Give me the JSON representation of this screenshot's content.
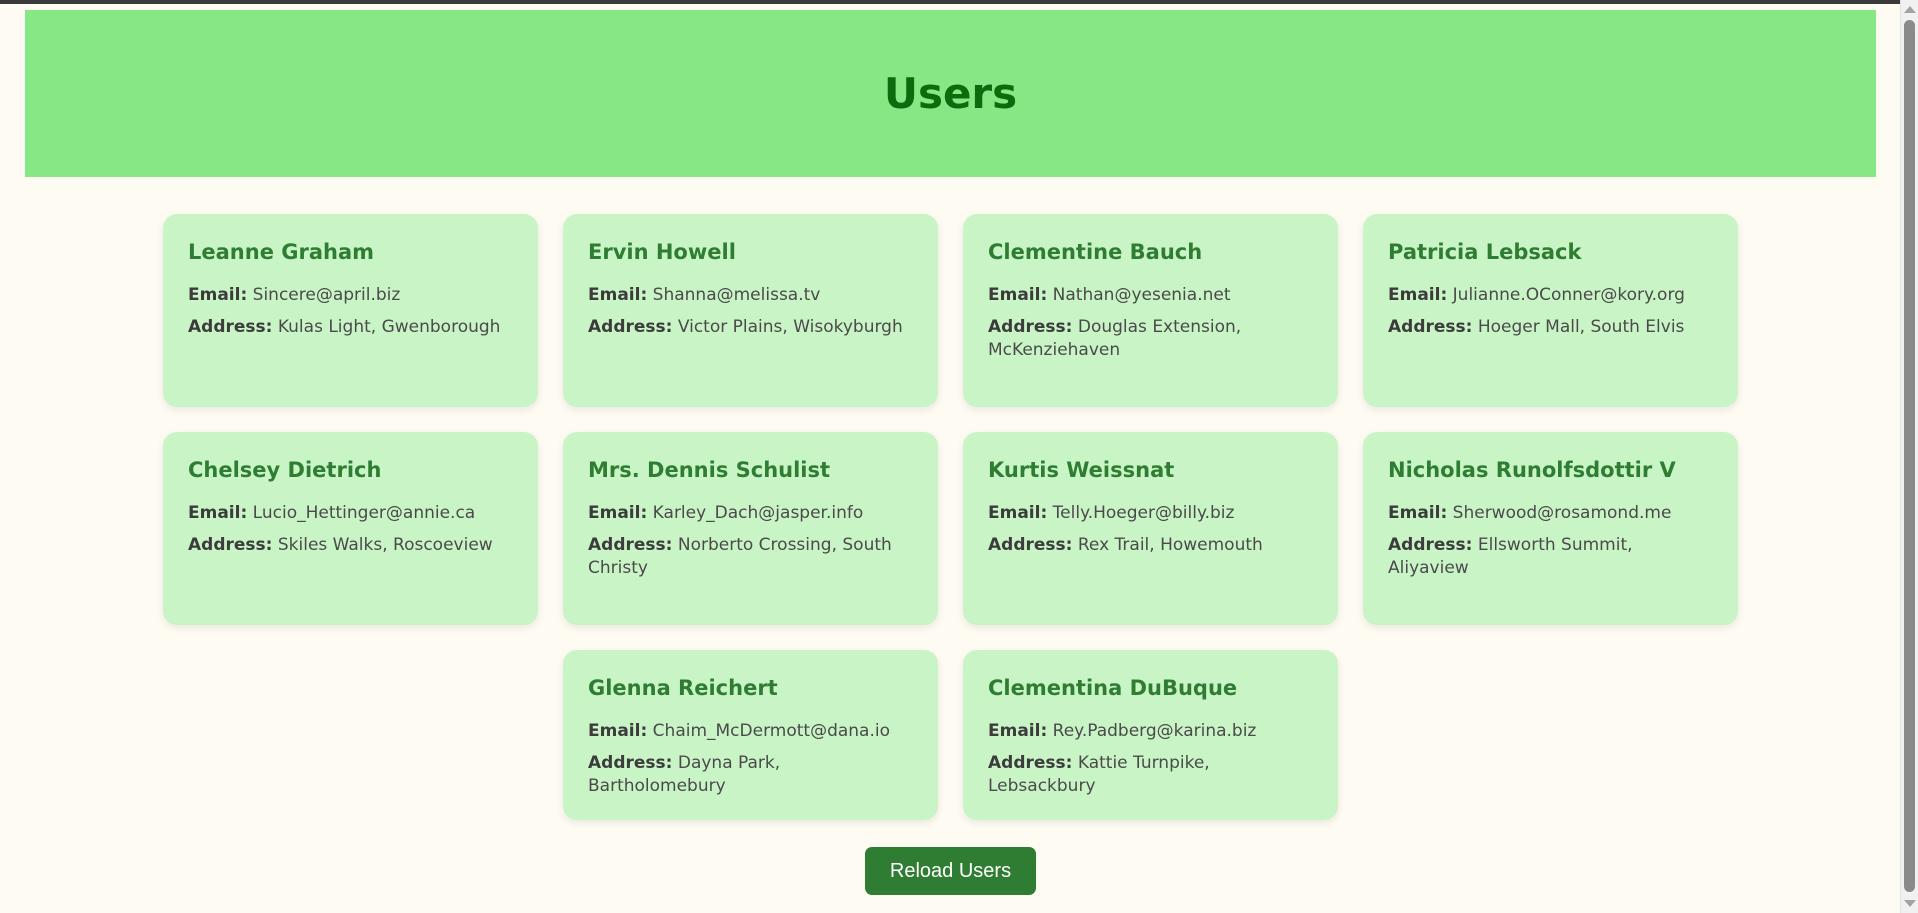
{
  "header": {
    "title": "Users"
  },
  "labels": {
    "email": "Email:",
    "address": "Address:"
  },
  "users": [
    {
      "name": "Leanne Graham",
      "email": "Sincere@april.biz",
      "address": "Kulas Light, Gwenborough"
    },
    {
      "name": "Ervin Howell",
      "email": "Shanna@melissa.tv",
      "address": "Victor Plains, Wisokyburgh"
    },
    {
      "name": "Clementine Bauch",
      "email": "Nathan@yesenia.net",
      "address": "Douglas Extension, McKenziehaven"
    },
    {
      "name": "Patricia Lebsack",
      "email": "Julianne.OConner@kory.org",
      "address": "Hoeger Mall, South Elvis"
    },
    {
      "name": "Chelsey Dietrich",
      "email": "Lucio_Hettinger@annie.ca",
      "address": "Skiles Walks, Roscoeview"
    },
    {
      "name": "Mrs. Dennis Schulist",
      "email": "Karley_Dach@jasper.info",
      "address": "Norberto Crossing, South Christy"
    },
    {
      "name": "Kurtis Weissnat",
      "email": "Telly.Hoeger@billy.biz",
      "address": "Rex Trail, Howemouth"
    },
    {
      "name": "Nicholas Runolfsdottir V",
      "email": "Sherwood@rosamond.me",
      "address": "Ellsworth Summit, Aliyaview"
    },
    {
      "name": "Glenna Reichert",
      "email": "Chaim_McDermott@dana.io",
      "address": "Dayna Park, Bartholomebury"
    },
    {
      "name": "Clementina DuBuque",
      "email": "Rey.Padberg@karina.biz",
      "address": "Kattie Turnpike, Lebsackbury"
    }
  ],
  "actions": {
    "reload_label": "Reload Users"
  },
  "colors": {
    "header_bg": "#85e885",
    "title": "#0c6b0c",
    "card_bg": "#c9f5c6",
    "card_name": "#2e7d32",
    "button_bg": "#2e7d32",
    "page_bg": "#fdfbf2"
  }
}
